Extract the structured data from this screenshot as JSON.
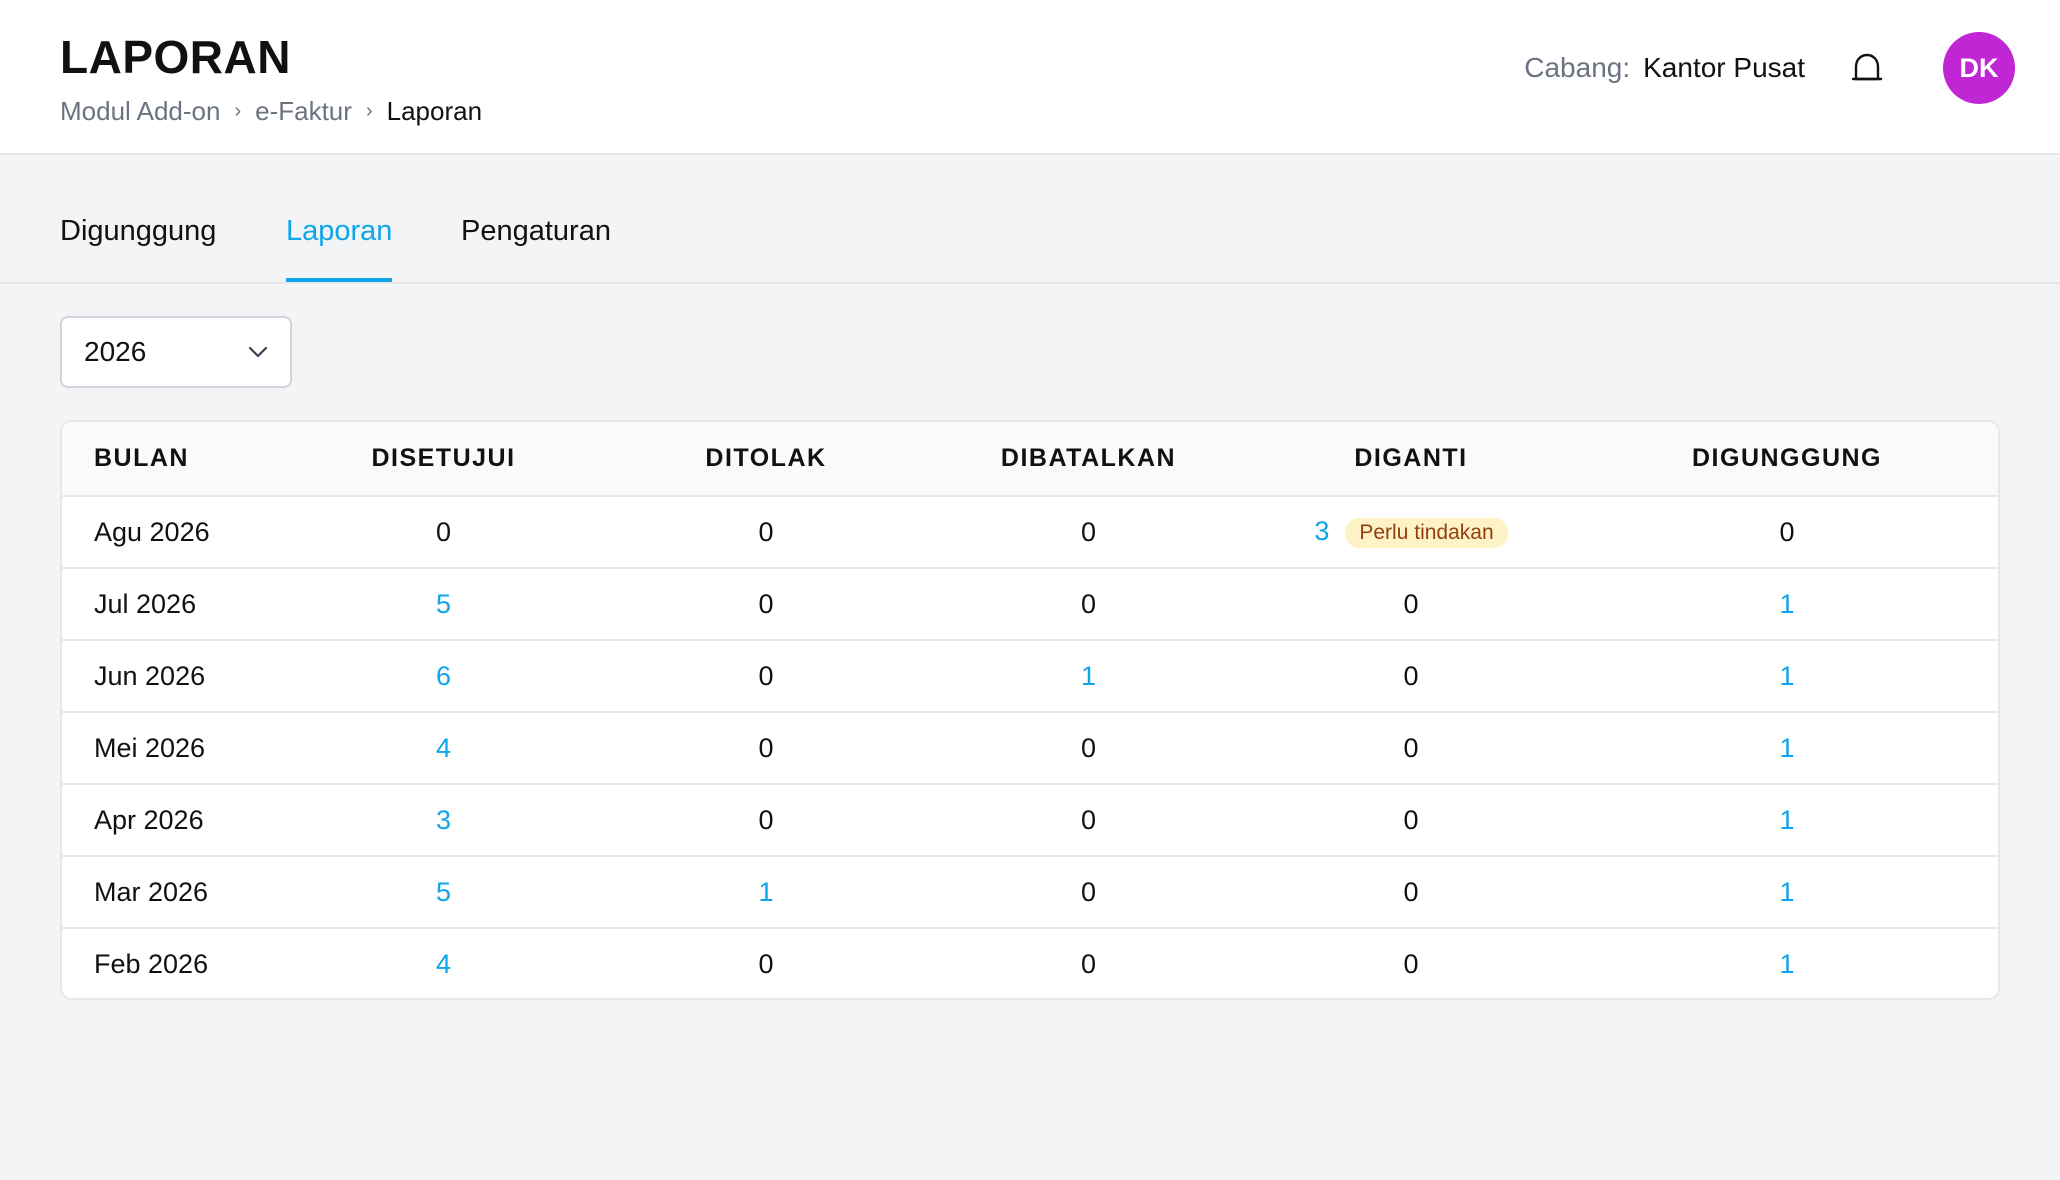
{
  "header": {
    "title": "LAPORAN",
    "breadcrumb": [
      "Modul Add-on",
      "e-Faktur",
      "Laporan"
    ],
    "branch_label": "Cabang:",
    "branch_value": "Kantor Pusat",
    "avatar_initials": "DK",
    "avatar_color": "#c026d3"
  },
  "tabs": [
    {
      "label": "Digunggung",
      "active": false
    },
    {
      "label": "Laporan",
      "active": true
    },
    {
      "label": "Pengaturan",
      "active": false
    }
  ],
  "filter": {
    "year": "2026"
  },
  "table": {
    "columns": [
      "BULAN",
      "DISETUJUI",
      "DITOLAK",
      "DIBATALKAN",
      "DIGANTI",
      "DIGUNGGUNG"
    ],
    "rows": [
      {
        "bulan": "Agu 2026",
        "disetujui": "0",
        "ditolak": "0",
        "dibatalkan": "0",
        "diganti": "3",
        "diganti_badge": "Perlu tindakan",
        "digunggung": "0"
      },
      {
        "bulan": "Jul 2026",
        "disetujui": "5",
        "ditolak": "0",
        "dibatalkan": "0",
        "diganti": "0",
        "digunggung": "1"
      },
      {
        "bulan": "Jun 2026",
        "disetujui": "6",
        "ditolak": "0",
        "dibatalkan": "1",
        "diganti": "0",
        "digunggung": "1"
      },
      {
        "bulan": "Mei 2026",
        "disetujui": "4",
        "ditolak": "0",
        "dibatalkan": "0",
        "diganti": "0",
        "digunggung": "1"
      },
      {
        "bulan": "Apr 2026",
        "disetujui": "3",
        "ditolak": "0",
        "dibatalkan": "0",
        "diganti": "0",
        "digunggung": "1"
      },
      {
        "bulan": "Mar 2026",
        "disetujui": "5",
        "ditolak": "1",
        "dibatalkan": "0",
        "diganti": "0",
        "digunggung": "1"
      },
      {
        "bulan": "Feb 2026",
        "disetujui": "4",
        "ditolak": "0",
        "dibatalkan": "0",
        "diganti": "0",
        "digunggung": "1"
      }
    ]
  },
  "colors": {
    "accent": "#0ea5e9",
    "badge_bg": "#fef3c7",
    "badge_text": "#92400e"
  }
}
